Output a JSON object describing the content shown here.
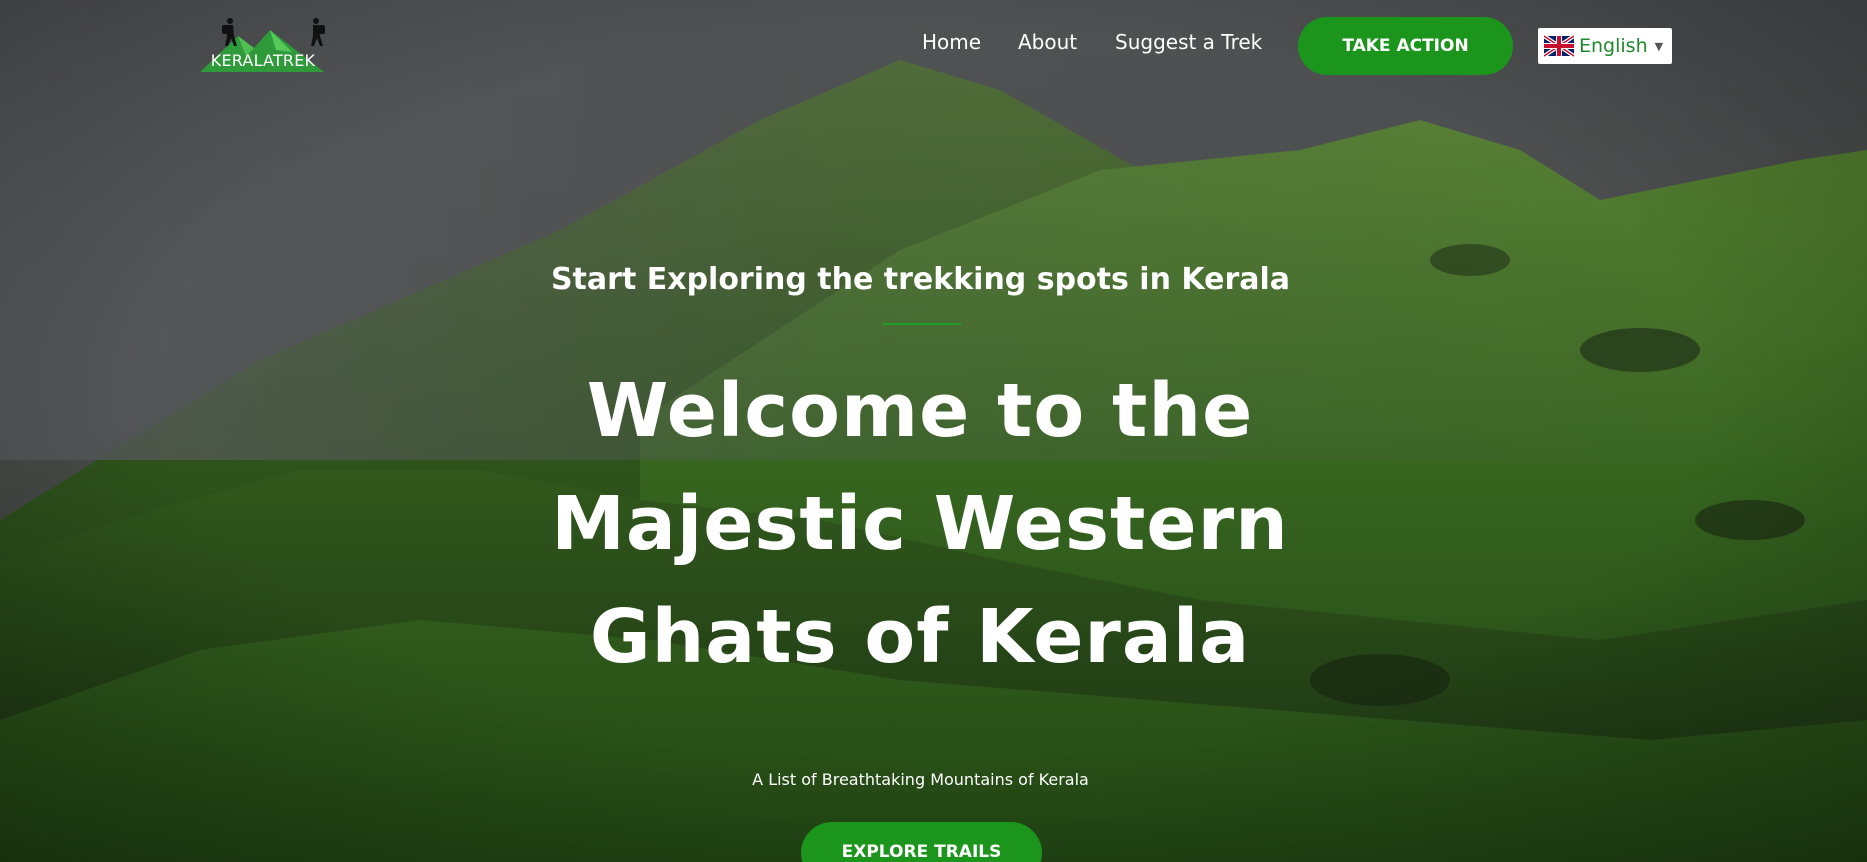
{
  "header": {
    "logo_text": "KERALATREK",
    "nav": [
      {
        "label": "Home"
      },
      {
        "label": "About"
      },
      {
        "label": "Suggest a Trek"
      }
    ],
    "cta_label": "TAKE ACTION",
    "language": {
      "selected": "English",
      "flag_icon": "uk-flag-icon"
    }
  },
  "hero": {
    "subtitle": "Start Exploring the trekking spots in Kerala",
    "title": "Welcome to the Majestic Western Ghats of Kerala",
    "tagline": "A List of Breathtaking Mountains of Kerala",
    "button_label": "EXPLORE TRAILS"
  },
  "colors": {
    "accent_green": "#1c951c",
    "divider_green": "#1f9e25",
    "language_text": "#1f8a2a"
  }
}
